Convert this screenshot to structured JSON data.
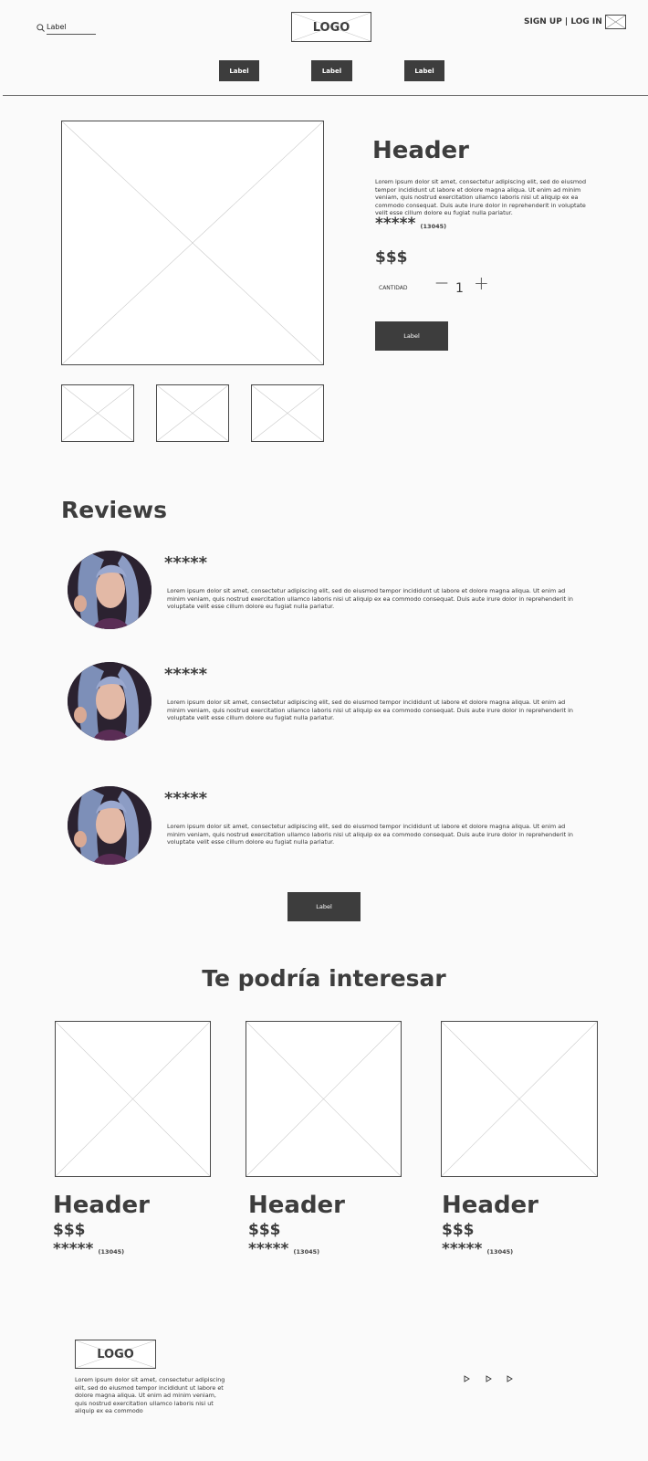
{
  "topbar": {
    "search_label": "Label",
    "logo": "LOGO",
    "auth": "SIGN UP | LOG IN",
    "nav": [
      "Label",
      "Label",
      "Label"
    ]
  },
  "product": {
    "header": "Header",
    "description": "Lorem ipsum dolor sit amet, consectetur adipiscing elit, sed do eiusmod tempor incididunt ut labore et dolore magna aliqua. Ut enim ad minim veniam, quis nostrud exercitation ullamco laboris nisi ut aliquip ex ea commodo consequat. Duis aute irure dolor in reprehenderit in voluptate velit esse cillum dolore eu fugiat nulla pariatur.",
    "stars": "*****",
    "rating_count": "(13045)",
    "price": "$$$",
    "quantity_label": "CANTIDAD",
    "quantity_minus": "—",
    "quantity": "1",
    "quantity_plus": "+",
    "button_label": "Label"
  },
  "reviews": {
    "title": "Reviews",
    "items": [
      {
        "stars": "*****",
        "text": "Lorem ipsum dolor sit amet, consectetur adipiscing elit, sed do eiusmod tempor incididunt ut labore et dolore magna aliqua. Ut enim ad minim veniam, quis nostrud exercitation ullamco laboris nisi ut aliquip ex ea commodo consequat. Duis aute irure dolor in reprehenderit in voluptate velit esse cillum dolore eu fugiat nulla pariatur."
      },
      {
        "stars": "*****",
        "text": "Lorem ipsum dolor sit amet, consectetur adipiscing elit, sed do eiusmod tempor incididunt ut labore et dolore magna aliqua. Ut enim ad minim veniam, quis nostrud exercitation ullamco laboris nisi ut aliquip ex ea commodo consequat. Duis aute irure dolor in reprehenderit in voluptate velit esse cillum dolore eu fugiat nulla pariatur."
      },
      {
        "stars": "*****",
        "text": "Lorem ipsum dolor sit amet, consectetur adipiscing elit, sed do eiusmod tempor incididunt ut labore et dolore magna aliqua. Ut enim ad minim veniam, quis nostrud exercitation ullamco laboris nisi ut aliquip ex ea commodo consequat. Duis aute irure dolor in reprehenderit in voluptate velit esse cillum dolore eu fugiat nulla pariatur."
      }
    ],
    "more_button": "Label"
  },
  "related": {
    "title": "Te podría interesar",
    "items": [
      {
        "header": "Header",
        "price": "$$$",
        "stars": "*****",
        "count": "(13045)"
      },
      {
        "header": "Header",
        "price": "$$$",
        "stars": "*****",
        "count": "(13045)"
      },
      {
        "header": "Header",
        "price": "$$$",
        "stars": "*****",
        "count": "(13045)"
      }
    ]
  },
  "footer": {
    "logo": "LOGO",
    "text": "Lorem ipsum dolor sit amet, consectetur adipiscing elit, sed do eiusmod tempor incididunt ut labore et dolore magna aliqua. Ut enim ad minim veniam, quis nostrud exercitation ullamco laboris nisi ut aliquip ex ea commodo",
    "social_icons": [
      "play-icon",
      "play-icon",
      "play-icon"
    ]
  },
  "colors": {
    "background": "#fafafa",
    "dark": "#3d3d3d"
  }
}
